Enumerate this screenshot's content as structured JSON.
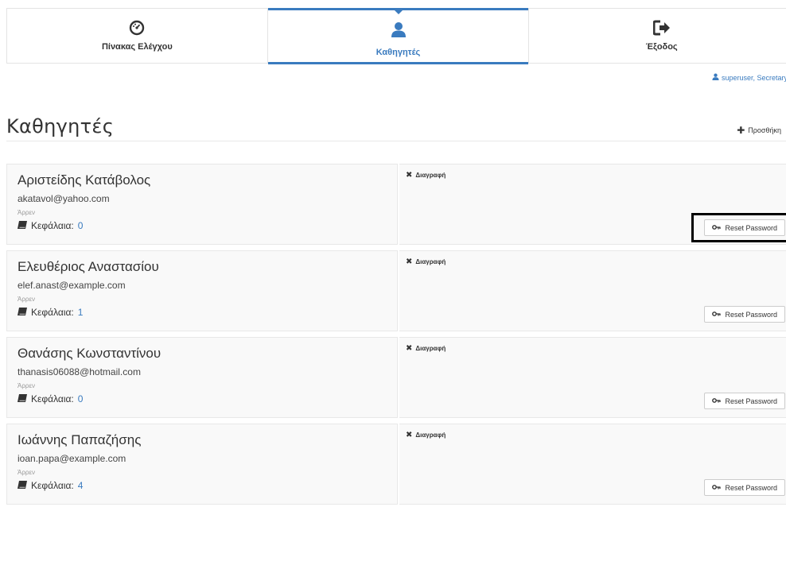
{
  "nav": {
    "dashboard": {
      "label": "Πίνακας Ελέγχου",
      "icon": "dashboard-gauge-icon"
    },
    "teachers": {
      "label": "Καθηγητές",
      "icon": "user-icon"
    },
    "exit": {
      "label": "Έξοδος",
      "icon": "sign-out-icon"
    }
  },
  "user": {
    "text": "superuser, Secretary",
    "icon": "user-icon"
  },
  "page": {
    "title": "Καθηγητές",
    "add_label": "Προσθήκη"
  },
  "colors": {
    "accent": "#3a7bbf",
    "card_bg": "#f9f9f9"
  },
  "teachers": [
    {
      "name": "Αριστείδης Κατάβολος",
      "email": "akatavol@yahoo.com",
      "gender": "Άρρεν",
      "chapters_label": "Κεφάλαια:",
      "chapters": "0",
      "delete_label": "Διαγραφή",
      "reset_label": "Reset Password",
      "highlighted": true
    },
    {
      "name": "Ελευθέριος Αναστασίου",
      "email": "elef.anast@example.com",
      "gender": "Άρρεν",
      "chapters_label": "Κεφάλαια:",
      "chapters": "1",
      "delete_label": "Διαγραφή",
      "reset_label": "Reset Password",
      "highlighted": false
    },
    {
      "name": "Θανάσης Κωνσταντίνου",
      "email": "thanasis06088@hotmail.com",
      "gender": "Άρρεν",
      "chapters_label": "Κεφάλαια:",
      "chapters": "0",
      "delete_label": "Διαγραφή",
      "reset_label": "Reset Password",
      "highlighted": false
    },
    {
      "name": "Ιωάννης Παπαζήσης",
      "email": "ioan.papa@example.com",
      "gender": "Άρρεν",
      "chapters_label": "Κεφάλαια:",
      "chapters": "4",
      "delete_label": "Διαγραφή",
      "reset_label": "Reset Password",
      "highlighted": false
    }
  ]
}
